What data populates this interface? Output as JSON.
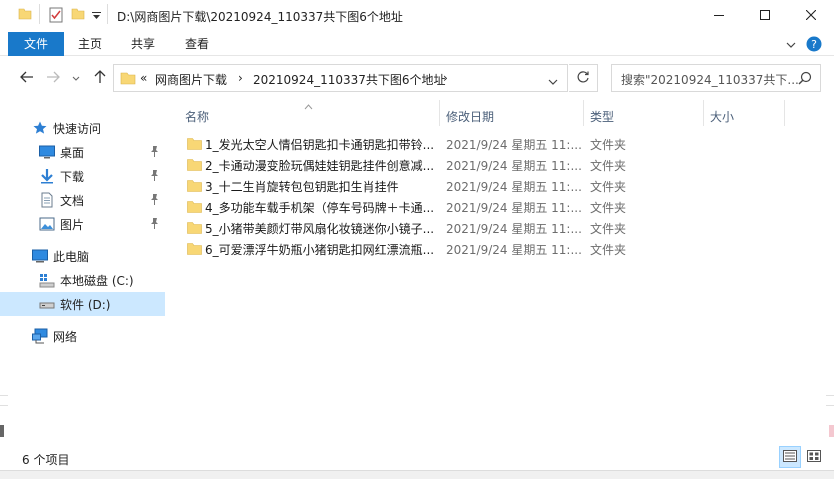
{
  "window": {
    "title": "D:\\网商图片下载\\20210924_110337共下图6个地址",
    "controls": {
      "minimize": "minimize-icon",
      "maximize": "maximize-icon",
      "close": "close-icon"
    }
  },
  "ribbon": {
    "tabs": [
      {
        "label": "文件"
      },
      {
        "label": "主页"
      },
      {
        "label": "共享"
      },
      {
        "label": "查看"
      }
    ]
  },
  "address": {
    "overflow": "«",
    "crumbs": [
      "网商图片下载",
      "20210924_110337共下图6个地址"
    ],
    "search_placeholder": "搜索\"20210924_110337共下..."
  },
  "nav": {
    "quick_access": "快速访问",
    "items": [
      {
        "label": "桌面",
        "icon": "desktop-icon"
      },
      {
        "label": "下载",
        "icon": "download-icon"
      },
      {
        "label": "文档",
        "icon": "document-icon"
      },
      {
        "label": "图片",
        "icon": "picture-icon"
      }
    ],
    "this_pc": "此电脑",
    "drives": [
      {
        "label": "本地磁盘 (C:)"
      },
      {
        "label": "软件 (D:)"
      }
    ],
    "network": "网络"
  },
  "columns": {
    "name": "名称",
    "date": "修改日期",
    "type": "类型",
    "size": "大小"
  },
  "files": [
    {
      "name": "1_发光太空人情侣钥匙扣卡通钥匙扣带铃...",
      "date": "2021/9/24 星期五 11:...",
      "type": "文件夹"
    },
    {
      "name": "2_卡通动漫变脸玩偶娃娃钥匙挂件创意减...",
      "date": "2021/9/24 星期五 11:...",
      "type": "文件夹"
    },
    {
      "name": "3_十二生肖旋转包包钥匙扣生肖挂件",
      "date": "2021/9/24 星期五 11:...",
      "type": "文件夹"
    },
    {
      "name": "4_多功能车载手机架（停车号码牌＋卡通...",
      "date": "2021/9/24 星期五 11:...",
      "type": "文件夹"
    },
    {
      "name": "5_小猪带美颜灯带风扇化妆镜迷你小镜子...",
      "date": "2021/9/24 星期五 11:...",
      "type": "文件夹"
    },
    {
      "name": "6_可爱漂浮牛奶瓶小猪钥匙扣网红漂流瓶...",
      "date": "2021/9/24 星期五 11:...",
      "type": "文件夹"
    }
  ],
  "status": {
    "count": "6 个项目"
  },
  "colors": {
    "accent": "#1979ca",
    "selection": "#cce8ff",
    "folder": "#f8d775"
  }
}
